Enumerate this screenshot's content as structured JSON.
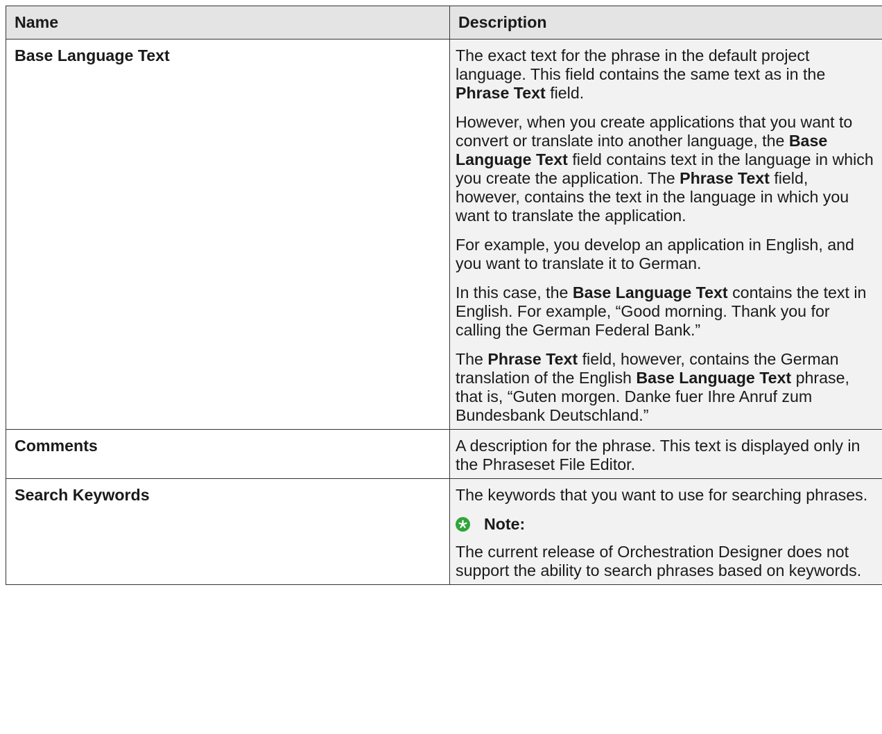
{
  "table": {
    "headers": {
      "name": "Name",
      "description": "Description"
    },
    "rows": [
      {
        "name": "Base Language Text",
        "paragraphs": [
          [
            {
              "t": "The exact text for the phrase in the default project language. This field contains the same text as in the "
            },
            {
              "t": "Phrase Text",
              "b": true
            },
            {
              "t": " field."
            }
          ],
          [
            {
              "t": "However, when you create applications that you want to convert or translate into another language, the "
            },
            {
              "t": "Base Language Text",
              "b": true
            },
            {
              "t": " field contains text in the language in which you create the application. The "
            },
            {
              "t": "Phrase Text",
              "b": true
            },
            {
              "t": " field, however, contains the text in the language in which you want to translate the application."
            }
          ],
          [
            {
              "t": "For example, you develop an application in English, and you want to translate it to German."
            }
          ],
          [
            {
              "t": "In this case, the "
            },
            {
              "t": "Base Language Text",
              "b": true
            },
            {
              "t": " contains the text in English. For example, “Good morning. Thank you for calling the German Federal Bank.”"
            }
          ],
          [
            {
              "t": "The "
            },
            {
              "t": "Phrase Text",
              "b": true
            },
            {
              "t": " field, however, contains the German translation of the English "
            },
            {
              "t": "Base Language Text",
              "b": true
            },
            {
              "t": " phrase, that is, “Guten morgen. Danke fuer Ihre Anruf zum Bundesbank Deutschland.”"
            }
          ]
        ]
      },
      {
        "name": "Comments",
        "paragraphs": [
          [
            {
              "t": "A description for the phrase. This text is displayed only in the Phraseset File Editor."
            }
          ]
        ]
      },
      {
        "name": "Search Keywords",
        "paragraphs": [
          [
            {
              "t": "The keywords that you want to use for searching phrases."
            }
          ]
        ],
        "note": {
          "icon": "asterisk-icon",
          "icon_color": "#30a43a",
          "label": "Note:",
          "text": "The current release of Orchestration Designer does not support the ability to search phrases based on keywords."
        }
      }
    ]
  },
  "colors": {
    "header_bg": "#e4e4e4",
    "description_bg": "#f2f2f2",
    "border": "#333333"
  }
}
